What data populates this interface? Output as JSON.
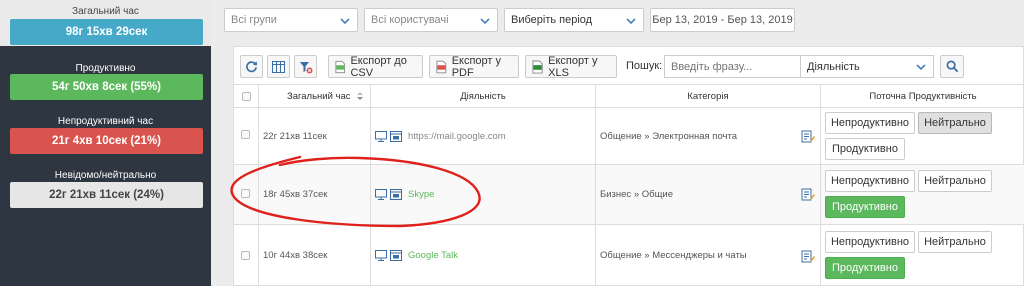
{
  "sidebar": {
    "total": {
      "label": "Загальний час",
      "value": "98г 15хв 29сек"
    },
    "productive": {
      "label": "Продуктивно",
      "value": "54г 50хв 8сек (55%)"
    },
    "unproductive": {
      "label": "Непродуктивний час",
      "value": "21г 4хв 10сек (21%)"
    },
    "neutral": {
      "label": "Невідомо/нейтрально",
      "value": "22г 21хв 11сек (24%)"
    }
  },
  "filters": {
    "groups": "Всі групи",
    "users": "Всі користувачі",
    "period": "Виберіть період",
    "date_range": "Бер 13, 2019 - Бер 13, 2019"
  },
  "toolbar": {
    "export_csv": "Експорт до CSV",
    "export_pdf": "Експорт у PDF",
    "export_xls": "Експорт у XLS",
    "search_label": "Пошук:",
    "search_placeholder": "Введіть фразу...",
    "activity_select": "Діяльність"
  },
  "table": {
    "headers": {
      "total_time": "Загальний час",
      "activity": "Діяльність",
      "category": "Категорія",
      "productivity": "Поточна Продуктивність"
    },
    "rows": [
      {
        "time": "22г 21хв 11сек",
        "activity": "https://mail.google.com",
        "category": "Общение » Электронная почта",
        "state": "neutral"
      },
      {
        "time": "18г 45хв 37сек",
        "activity": "Skype",
        "category": "Бизнес » Общие",
        "state": "productive"
      },
      {
        "time": "10г 44хв 38сек",
        "activity": "Google Talk",
        "category": "Общение » Мессенджеры и чаты",
        "state": "productive"
      }
    ],
    "buttons": {
      "unproductive": "Непродуктивно",
      "neutral": "Нейтрально",
      "productive": "Продуктивно"
    }
  },
  "colors": {
    "sidebar_bg": "#2d3641",
    "total": "#46a9c7",
    "productive": "#5cb85c",
    "unproductive": "#d9534f",
    "neutral": "#e6e6e6",
    "annotation": "#e0201b"
  },
  "icons": [
    "refresh-icon",
    "columns-icon",
    "filter-clear-icon",
    "csv-file-icon",
    "pdf-file-icon",
    "xls-file-icon",
    "search-icon",
    "chevron-down-icon",
    "monitor-icon",
    "window-icon",
    "category-edit-icon"
  ]
}
